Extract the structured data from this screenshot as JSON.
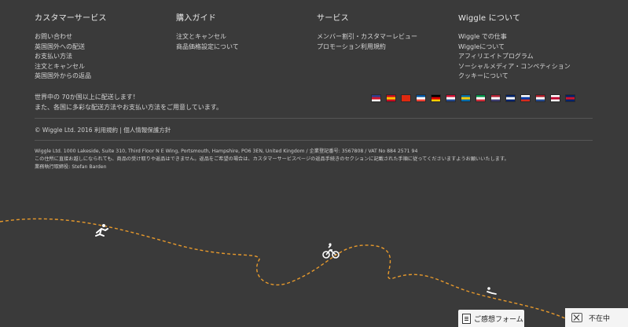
{
  "columns": [
    {
      "heading": "カスタマーサービス",
      "items": [
        "お問い合わせ",
        "英国国外への配送",
        "お支払い方法",
        "注文とキャンセル",
        "英国国外からの返品"
      ]
    },
    {
      "heading": "購入ガイド",
      "items": [
        "注文とキャンセル",
        "商品価格設定について"
      ]
    },
    {
      "heading": "サービス",
      "items": [
        "メンバー割引・カスタマーレビュー",
        "プロモーション利用規約"
      ]
    },
    {
      "heading": "Wiggle について",
      "items": [
        "Wiggle での仕事",
        "Wiggleについて",
        "アフィリエイトプログラム",
        "ソーシャルメディア・コンペティション",
        "クッキーについて"
      ]
    }
  ],
  "shipping": {
    "line1": "世界中の 70か国以上に配送します！",
    "line2": "また、各国に多彩な配送方法やお支払い方法をご用意しています。"
  },
  "flags": [
    {
      "name": "flag-uk",
      "colors": [
        "#2b3f8f",
        "#d0162c",
        "#ffffff"
      ]
    },
    {
      "name": "flag-spain",
      "colors": [
        "#c60b1e",
        "#ffc400",
        "#c60b1e"
      ]
    },
    {
      "name": "flag-china",
      "colors": [
        "#de2910",
        "#de2910",
        "#de2910"
      ]
    },
    {
      "name": "flag-france",
      "colors": [
        "#0055a4",
        "#ffffff",
        "#ef4135"
      ]
    },
    {
      "name": "flag-germany",
      "colors": [
        "#000000",
        "#dd0000",
        "#ffce00"
      ]
    },
    {
      "name": "flag-netherlands-alt",
      "colors": [
        "#d21034",
        "#ffffff",
        "#21468b"
      ]
    },
    {
      "name": "flag-sweden",
      "colors": [
        "#006aa7",
        "#fecc00",
        "#006aa7"
      ]
    },
    {
      "name": "flag-italy",
      "colors": [
        "#009246",
        "#ffffff",
        "#ce2b37"
      ]
    },
    {
      "name": "flag-usa",
      "colors": [
        "#b22234",
        "#ffffff",
        "#3c3b6e"
      ]
    },
    {
      "name": "flag-australia",
      "colors": [
        "#012169",
        "#ffffff",
        "#012169"
      ]
    },
    {
      "name": "flag-russia",
      "colors": [
        "#ffffff",
        "#0039a6",
        "#d52b1e"
      ]
    },
    {
      "name": "flag-netherlands",
      "colors": [
        "#ae1c28",
        "#ffffff",
        "#21468b"
      ]
    },
    {
      "name": "flag-japan",
      "colors": [
        "#ffffff",
        "#bc002d",
        "#ffffff"
      ]
    },
    {
      "name": "flag-new-zealand",
      "colors": [
        "#012169",
        "#cc142b",
        "#012169"
      ]
    }
  ],
  "footer": {
    "copyright": "© Wiggle Ltd. 2016",
    "terms": "利用規約",
    "separator": "|",
    "privacy": "個人情報保護方針"
  },
  "legal": {
    "line1": "Wiggle Ltd. 1000 Lakeside, Suite 310, Third Floor N E Wing, Portsmouth, Hampshire, PO6 3EN, United Kingdom / 企業登記番号: 3567808 / VAT No 884 2571 94",
    "line2": "この住所に直接お越しになられても、商品の受け取りや返品はできません。返品をご希望の場合は、カスタマーサービスページの返品手続きのセクションに記載された手順に従ってくださいますようお願いいたします。",
    "line3": "業務執行取締役: Stefan Barden"
  },
  "widgets": {
    "feedback_label": "ご感想フォーム",
    "status_label": "不在中"
  },
  "colors": {
    "background": "#3a3a3a",
    "path": "#e89a2c"
  }
}
